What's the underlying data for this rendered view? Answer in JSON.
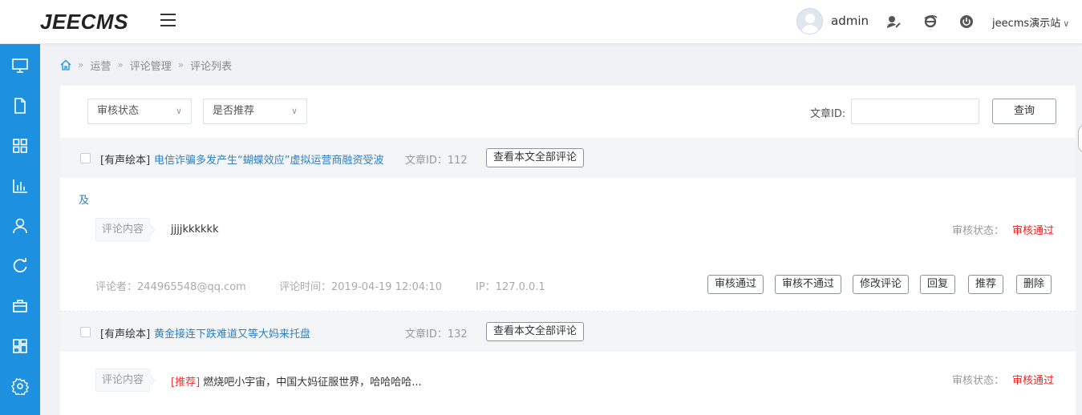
{
  "header": {
    "logo": "JEECMS",
    "user": "admin",
    "site": "jeecms演示站",
    "icons": [
      "user-edit-icon",
      "ie-browser-icon",
      "power-icon"
    ]
  },
  "sidebar": {
    "icons": [
      "monitor-icon",
      "document-icon",
      "grid-icon",
      "bar-chart-icon",
      "user-icon",
      "refresh-icon",
      "toolbox-icon",
      "dashboard-icon",
      "gear-icon"
    ]
  },
  "breadcrumb": [
    "运营",
    "评论管理",
    "评论列表"
  ],
  "filters": {
    "audit_status": "审核状态",
    "recommend": "是否推荐",
    "article_id_label": "文章ID:",
    "article_id_value": "",
    "query_button": "查询"
  },
  "articles": [
    {
      "tag": "[有声绘本]",
      "title": "电信诈骗多发产生“蝴蝶效应”虚拟运营商融资受波",
      "title_wrap": "及",
      "article_id": "文章ID：112",
      "view_all": "查看本文全部评论",
      "comment": {
        "label": "评论内容",
        "recommend_tag": "",
        "text": "jjjjkkkkkk",
        "status_label": "审核状态：",
        "status": "审核通过",
        "author": "评论者：244965548@qq.com",
        "time": "评论时间：2019-04-19 12:04:10",
        "ip": "IP：127.0.0.1",
        "actions": [
          "审核通过",
          "审核不通过",
          "修改评论",
          "回复",
          "推荐",
          "删除"
        ]
      }
    },
    {
      "tag": "[有声绘本]",
      "title": "黄金接连下跌难道又等大妈来托盘",
      "article_id": "文章ID：132",
      "view_all": "查看本文全部评论",
      "comment": {
        "label": "评论内容",
        "recommend_tag": "[推荐]",
        "text": "燃烧吧小宇宙，中国大妈征服世界，哈哈哈哈...",
        "status_label": "审核状态：",
        "status": "审核通过"
      }
    }
  ],
  "colors": {
    "sidebar": "#1e90e0",
    "link": "#2d7fc1",
    "status": "#e22"
  }
}
